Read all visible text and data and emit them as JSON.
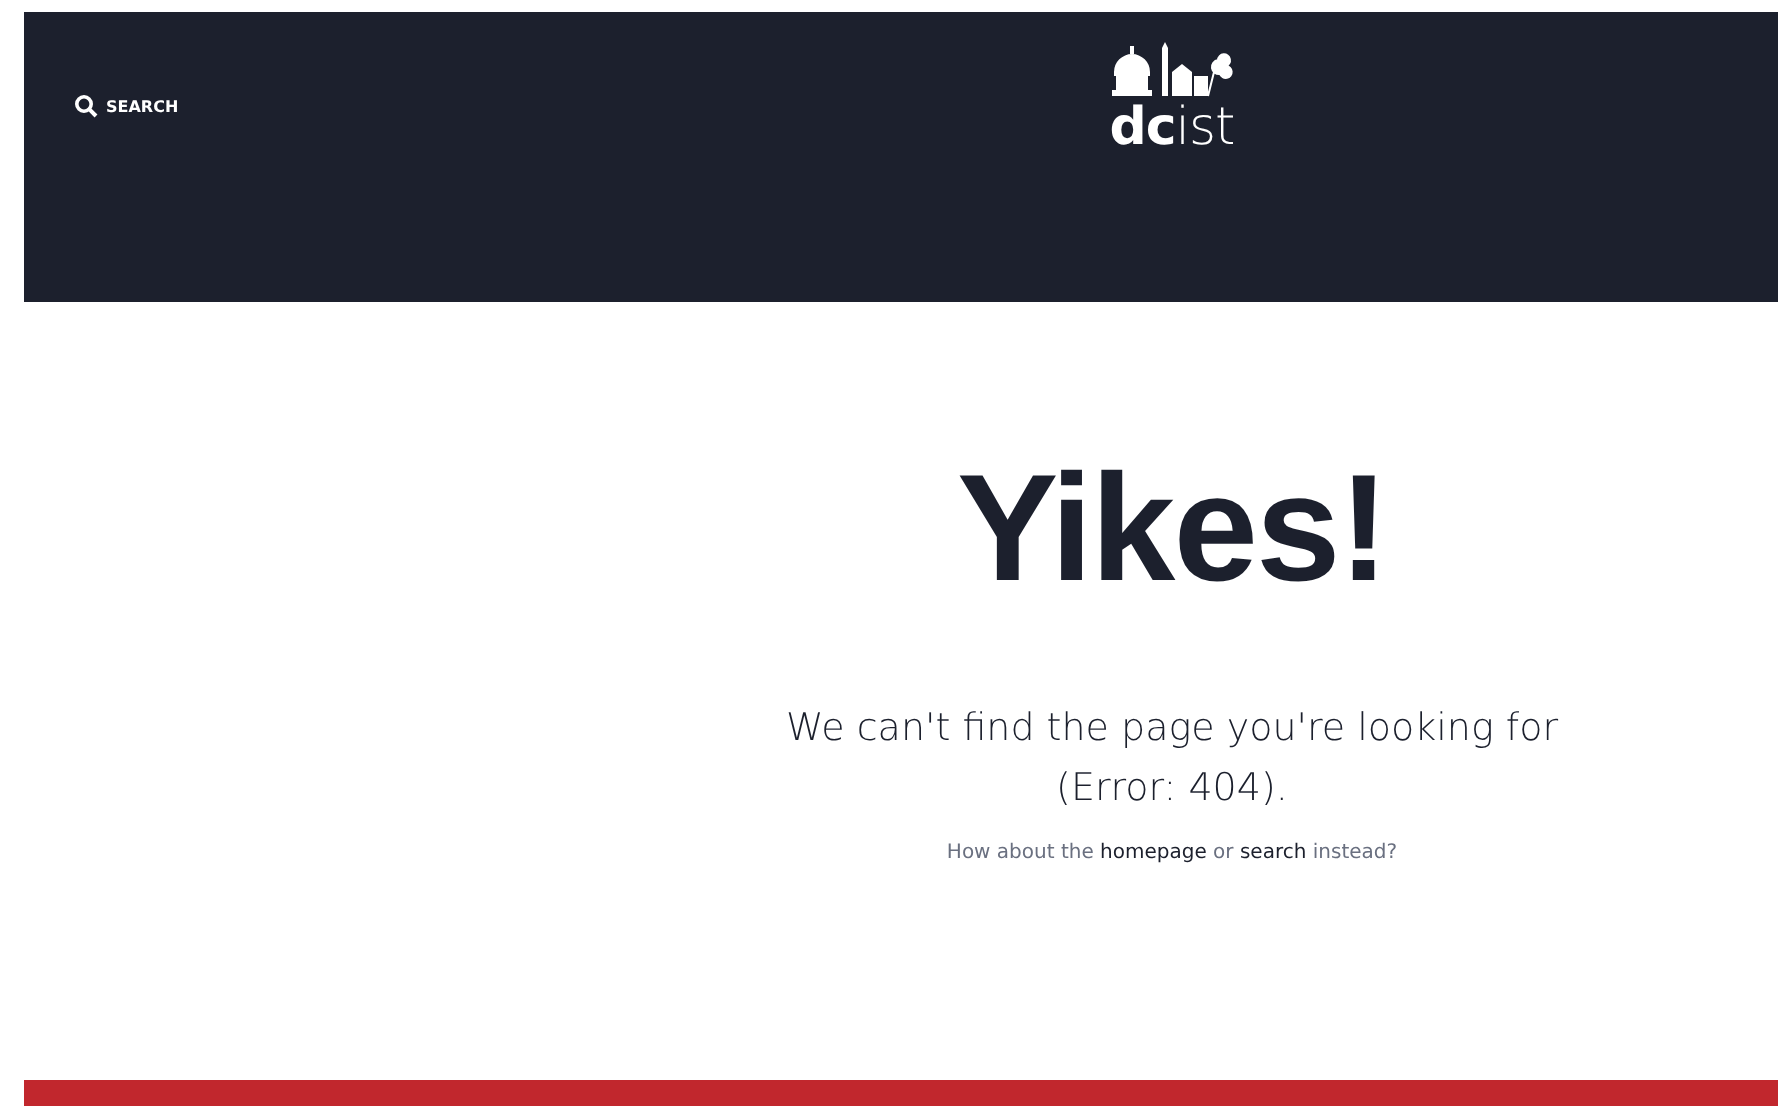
{
  "header": {
    "search_label": "SEARCH",
    "logo": {
      "text_bold": "dc",
      "text_light": "ist"
    }
  },
  "error": {
    "title": "Yikes!",
    "message_lines": [
      "We can't find the page you're looking for",
      "(Error: 404)."
    ],
    "suggestion": {
      "parts": [
        {
          "kind": "text",
          "text": "How about the "
        },
        {
          "kind": "link",
          "text": "homepage"
        },
        {
          "kind": "text",
          "text": " or "
        },
        {
          "kind": "link",
          "text": "search"
        },
        {
          "kind": "text",
          "text": " instead?"
        }
      ]
    }
  }
}
